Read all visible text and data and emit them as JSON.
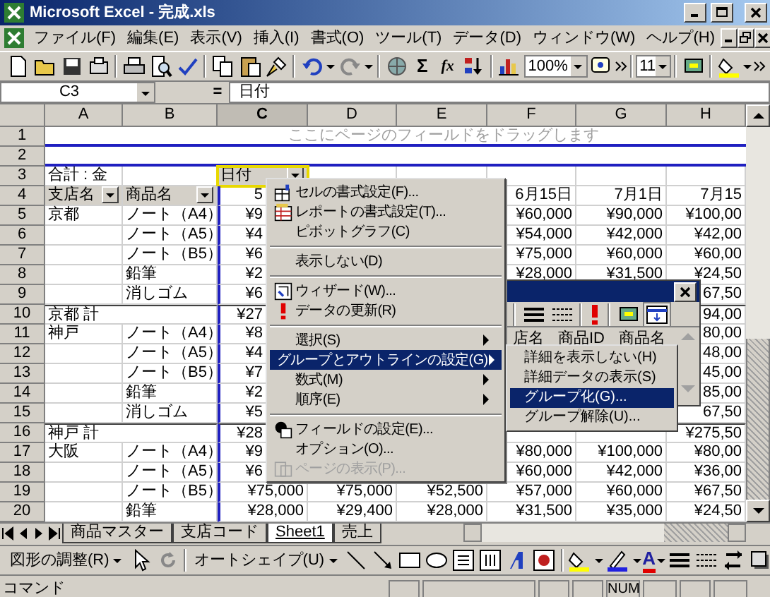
{
  "window": {
    "title": "Microsoft Excel - 完成.xls"
  },
  "menu_bar": [
    "ファイル(F)",
    "編集(E)",
    "表示(V)",
    "挿入(I)",
    "書式(O)",
    "ツール(T)",
    "データ(D)",
    "ウィンドウ(W)",
    "ヘルプ(H)"
  ],
  "toolbar": {
    "autosum": "Σ",
    "function": "fx",
    "zoom": "100%",
    "font_size": "11"
  },
  "formula_bar": {
    "name_box": "C3",
    "equals": "=",
    "value": "日付"
  },
  "columns": [
    {
      "label": "A",
      "selected": false
    },
    {
      "label": "B",
      "selected": false
    },
    {
      "label": "C",
      "selected": true
    },
    {
      "label": "D",
      "selected": false
    },
    {
      "label": "E",
      "selected": false
    },
    {
      "label": "F",
      "selected": false
    },
    {
      "label": "G",
      "selected": false
    },
    {
      "label": "H",
      "selected": false
    }
  ],
  "rows": [
    {
      "number": "1",
      "kind": "page",
      "hint": "ここにページのフィールドをドラッグします"
    },
    {
      "number": "2",
      "kind": "blank"
    },
    {
      "number": "3",
      "kind": "data",
      "cells": {
        "a": "合計 : 金",
        "c": {
          "text": "日付",
          "dropdown": true,
          "selected": true
        }
      }
    },
    {
      "number": "4",
      "kind": "data",
      "cells": {
        "a": {
          "text": "支店名",
          "dropdown": true,
          "selected": false
        },
        "b": {
          "text": "商品名",
          "dropdown": true,
          "selected": false
        },
        "c": "5",
        "f": "6月15日",
        "g": "7月1日",
        "h": "7月15"
      }
    },
    {
      "number": "5",
      "kind": "data",
      "cells": {
        "a": "京都",
        "b": "ノート（A4）",
        "c": "¥9",
        "f": "¥60,000",
        "g": "¥90,000",
        "h": "¥100,00"
      }
    },
    {
      "number": "6",
      "kind": "data",
      "cells": {
        "b": "ノート（A5）",
        "c": "¥4",
        "f": "¥54,000",
        "g": "¥42,000",
        "h": "¥42,00"
      }
    },
    {
      "number": "7",
      "kind": "data",
      "cells": {
        "b": "ノート（B5）",
        "c": "¥6",
        "f": "¥75,000",
        "g": "¥60,000",
        "h": "¥60,00"
      }
    },
    {
      "number": "8",
      "kind": "data",
      "cells": {
        "b": "鉛筆",
        "c": "¥2",
        "f": "¥28,000",
        "g": "¥31,500",
        "h": "¥24,50"
      }
    },
    {
      "number": "9",
      "kind": "data",
      "cells": {
        "b": "消しゴム",
        "c": "¥6",
        "h": "67,50"
      }
    },
    {
      "number": "10",
      "kind": "subtotal",
      "cells": {
        "a": "京都 計",
        "c": "¥27",
        "h": "94,00"
      }
    },
    {
      "number": "11",
      "kind": "data",
      "cells": {
        "a": "神戸",
        "b": "ノート（A4）",
        "c": "¥8",
        "h": "80,00"
      }
    },
    {
      "number": "12",
      "kind": "data",
      "cells": {
        "b": "ノート（A5）",
        "c": "¥4",
        "h": "48,00"
      }
    },
    {
      "number": "13",
      "kind": "data",
      "cells": {
        "b": "ノート（B5）",
        "c": "¥7",
        "h": "45,00"
      }
    },
    {
      "number": "14",
      "kind": "data",
      "cells": {
        "b": "鉛筆",
        "c": "¥2",
        "h": "85,00"
      }
    },
    {
      "number": "15",
      "kind": "data",
      "cells": {
        "b": "消しゴム",
        "c": "¥5",
        "h": "67,50"
      }
    },
    {
      "number": "16",
      "kind": "subtotal",
      "cells": {
        "a": "神戸 計",
        "c": "¥28",
        "h": "¥275,50"
      }
    },
    {
      "number": "17",
      "kind": "data",
      "cells": {
        "a": "大阪",
        "b": "ノート（A4）",
        "c": "¥9",
        "f": "¥80,000",
        "g": "¥100,000",
        "h": "¥80,00"
      }
    },
    {
      "number": "18",
      "kind": "data",
      "cells": {
        "b": "ノート（A5）",
        "c": "¥6",
        "f": "¥60,000",
        "g": "¥42,000",
        "h": "¥36,00"
      }
    },
    {
      "number": "19",
      "kind": "data",
      "cells": {
        "b": "ノート（B5）",
        "c": "¥75,000",
        "d": "¥75,000",
        "e": "¥52,500",
        "f": "¥57,000",
        "g": "¥60,000",
        "h": "¥67,50"
      }
    },
    {
      "number": "20",
      "kind": "data",
      "cells": {
        "b": "鉛筆",
        "c": "¥28,000",
        "d": "¥29,400",
        "e": "¥28,000",
        "f": "¥31,500",
        "g": "¥35,000",
        "h": "¥24,50"
      }
    }
  ],
  "pivot_toolbar": {
    "fields": [
      "店名",
      "商品ID",
      "商品名"
    ]
  },
  "context_menu": {
    "items": [
      {
        "kind": "item",
        "label": "セルの書式設定(F)...",
        "submenu": false,
        "selected": false,
        "disabled": false
      },
      {
        "kind": "item",
        "label": "レポートの書式設定(T)...",
        "submenu": false,
        "selected": false,
        "disabled": false
      },
      {
        "kind": "item",
        "label": "ピボットグラフ(C)",
        "submenu": false,
        "selected": false,
        "disabled": false
      },
      {
        "kind": "separator"
      },
      {
        "kind": "item",
        "label": "表示しない(D)",
        "submenu": false,
        "selected": false,
        "disabled": false
      },
      {
        "kind": "separator"
      },
      {
        "kind": "item",
        "label": "ウィザード(W)...",
        "submenu": false,
        "selected": false,
        "disabled": false
      },
      {
        "kind": "item",
        "label": "データの更新(R)",
        "submenu": false,
        "selected": false,
        "disabled": false
      },
      {
        "kind": "separator"
      },
      {
        "kind": "item",
        "label": "選択(S)",
        "submenu": true,
        "selected": false,
        "disabled": false
      },
      {
        "kind": "item",
        "label": "グループとアウトラインの設定(G)",
        "submenu": true,
        "selected": true,
        "disabled": false
      },
      {
        "kind": "item",
        "label": "数式(M)",
        "submenu": true,
        "selected": false,
        "disabled": false
      },
      {
        "kind": "item",
        "label": "順序(E)",
        "submenu": true,
        "selected": false,
        "disabled": false
      },
      {
        "kind": "separator"
      },
      {
        "kind": "item",
        "label": "フィールドの設定(E)...",
        "submenu": false,
        "selected": false,
        "disabled": false
      },
      {
        "kind": "item",
        "label": "オプション(O)...",
        "submenu": false,
        "selected": false,
        "disabled": false
      },
      {
        "kind": "item",
        "label": "ページの表示(P)...",
        "submenu": false,
        "selected": false,
        "disabled": true
      }
    ]
  },
  "submenu": {
    "items": [
      {
        "label": "詳細を表示しない(H)",
        "selected": false
      },
      {
        "label": "詳細データの表示(S)",
        "selected": false
      },
      {
        "label": "グループ化(G)...",
        "selected": true
      },
      {
        "label": "グループ解除(U)...",
        "selected": false
      }
    ]
  },
  "sheet_tabs": [
    {
      "label": "商品マスター",
      "selected": false
    },
    {
      "label": "支店コード",
      "selected": false
    },
    {
      "label": "Sheet1",
      "selected": true
    },
    {
      "label": "売上",
      "selected": false
    }
  ],
  "drawing_toolbar": {
    "draw_menu": "図形の調整(R)",
    "autoshapes": "オートシェイプ(U)",
    "font_color": "A"
  },
  "status_bar": {
    "mode": "コマンド",
    "indicator": "NUM"
  }
}
